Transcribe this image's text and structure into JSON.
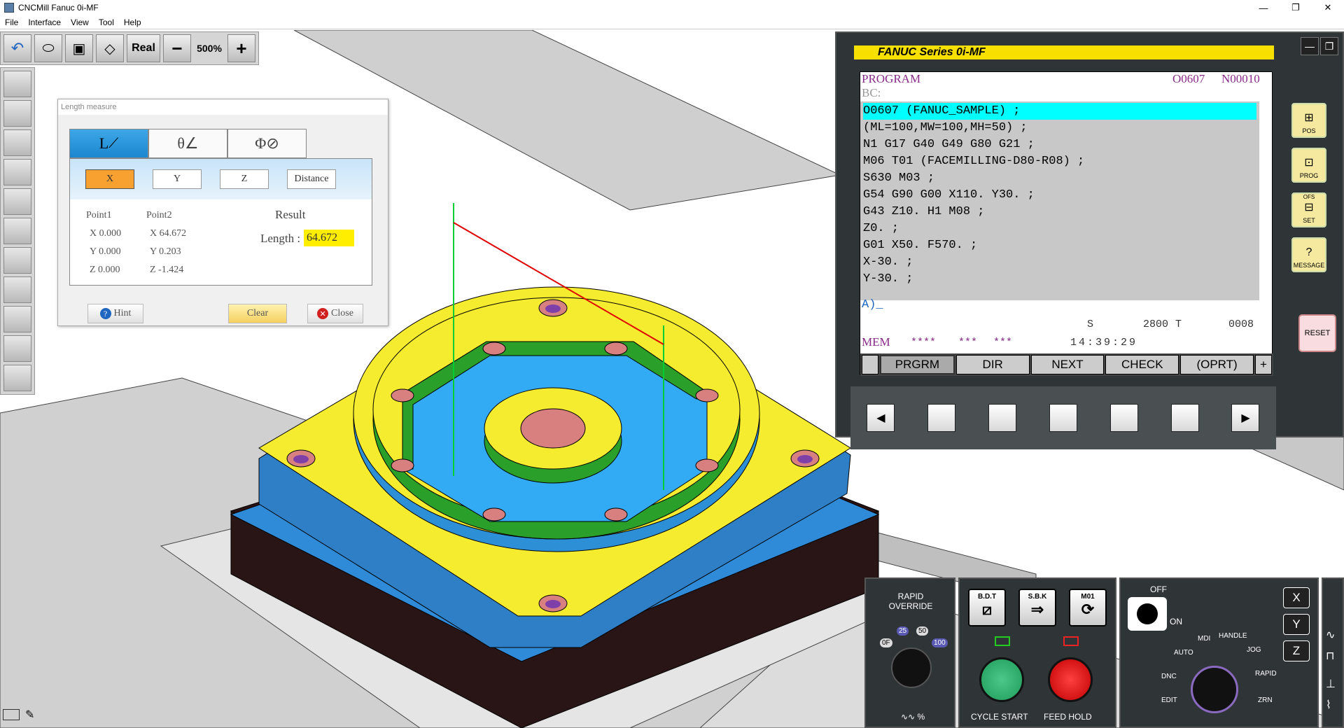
{
  "window": {
    "title": "CNCMill Fanuc 0i-MF",
    "min": "—",
    "max": "❐",
    "close": "✕"
  },
  "menu": [
    "File",
    "Interface",
    "View",
    "Tool",
    "Help"
  ],
  "toolbar": {
    "real_label": "Real",
    "zoom": "500%",
    "minus": "−",
    "plus": "+"
  },
  "length_measure": {
    "title": "Length measure",
    "tabs": [
      "L",
      "θ",
      "Φ"
    ],
    "axis_buttons": [
      "X",
      "Y",
      "Z",
      "Distance"
    ],
    "selected_axis": "X",
    "point1_label": "Point1",
    "point2_label": "Point2",
    "point1": [
      "X 0.000",
      "Y 0.000",
      "Z 0.000"
    ],
    "point2": [
      "X 64.672",
      "Y 0.203",
      "Z -1.424"
    ],
    "result_label": "Result",
    "length_label": "Length :",
    "length_value": "64.672",
    "hint": "Hint",
    "clear": "Clear",
    "close": "Close"
  },
  "fanuc": {
    "series": "FANUC Series 0i-MF",
    "screen": "PROGRAM",
    "program_no": "O0607",
    "seq_no": "N00010",
    "bc": "BC:",
    "lines": [
      "O0607 (FANUC_SAMPLE) ;",
      "(ML=100,MW=100,MH=50) ;",
      "N1 G17 G40 G49 G80 G21 ;",
      "M06 T01 (FACEMILLING-D80-R08) ;",
      "S630 M03 ;",
      "G54 G90 G00 X110. Y30. ;",
      "G43 Z10. H1 M08 ;",
      "Z0. ;",
      "G01 X50. F570. ;",
      "X-30. ;",
      "Y-30. ;"
    ],
    "input_prompt": "A)_",
    "s_label": "S",
    "s_value": "2800",
    "t_label": "T",
    "t_value": "0008",
    "mode": "MEM",
    "status1": "****",
    "status2": "***",
    "status3": "***",
    "time": "14:39:29",
    "softkeys": [
      "PRGRM",
      "DIR",
      "NEXT",
      "CHECK",
      "(OPRT)",
      "+"
    ],
    "side_keys": [
      "POS",
      "PROG",
      "SET",
      "MESSAGE"
    ],
    "ofs": "OFS",
    "reset": "RESET"
  },
  "operator": {
    "rapid_override": "RAPID OVERRIDE",
    "ro_values": [
      "0F",
      "25",
      "50",
      "100"
    ],
    "ro_unit": "%",
    "bdt": "B.D.T",
    "sbk": "S.B.K",
    "m01": "M01",
    "cycle_start": "CYCLE START",
    "feed_hold": "FEED HOLD",
    "off": "OFF",
    "on": "ON",
    "modes": [
      "AUTO",
      "MDI",
      "HANDLE",
      "JOG",
      "RAPID",
      "ZRN",
      "EDIT",
      "DNC"
    ],
    "axes": [
      "X",
      "Y",
      "Z"
    ]
  }
}
